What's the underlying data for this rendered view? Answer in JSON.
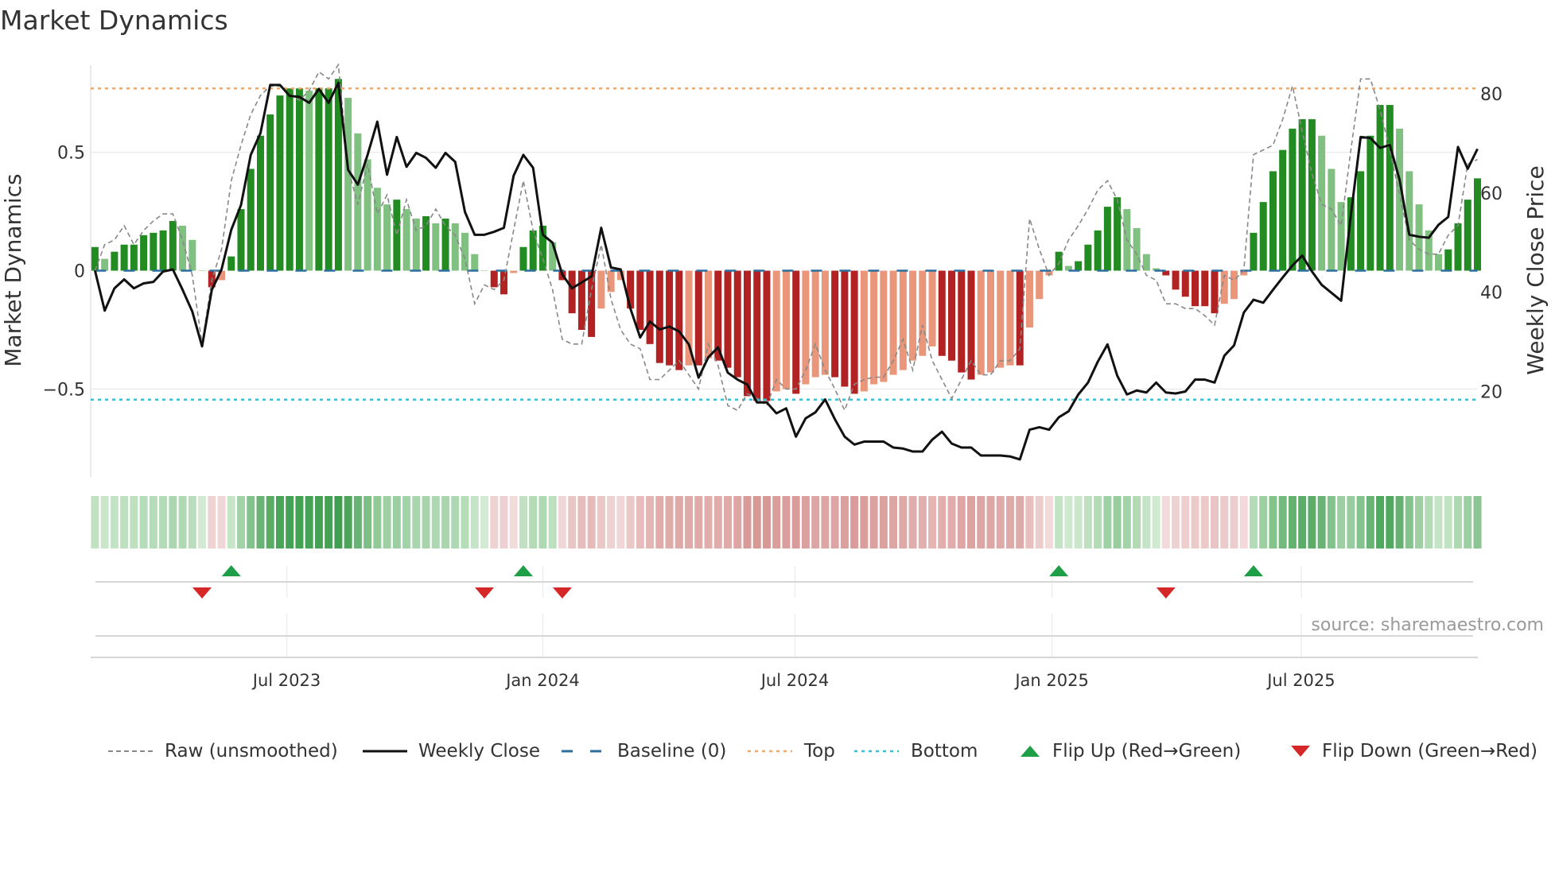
{
  "title": "Market Dynamics",
  "source": "source: sharemaestro.com",
  "legend": [
    {
      "label": "Raw (unsmoothed)",
      "icon": "dashed-gray-line"
    },
    {
      "label": "Weekly Close",
      "icon": "solid-black-line"
    },
    {
      "label": "Baseline (0)",
      "icon": "dashed-blue-line"
    },
    {
      "label": "Top",
      "icon": "dotted-orange-line"
    },
    {
      "label": "Bottom",
      "icon": "dotted-cyan-line"
    },
    {
      "label": "Flip Up (Red→Green)",
      "icon": "triangle-up"
    },
    {
      "label": "Flip Down (Green→Red)",
      "icon": "triangle-down"
    }
  ],
  "colors": {
    "pos_strong": "#228b22",
    "pos_weak": "#80c080",
    "neg_strong": "#b22222",
    "neg_weak": "#e9967a",
    "raw": "#888888",
    "close": "#111111",
    "baseline": "#2b6f9f",
    "top": "#f0a868",
    "bottom": "#2ec4d6",
    "flip_up": "#1f9e48",
    "flip_down": "#d62728"
  },
  "chart_data": {
    "type": "bar+line",
    "title": "Market Dynamics",
    "ylabel": "Market Dynamics",
    "y2label": "Weekly Close Price",
    "ylim": [
      -0.7,
      0.87
    ],
    "yticks": [
      {
        "v": 0.5,
        "label": "0.5"
      },
      {
        "v": 0,
        "label": "0"
      },
      {
        "v": -0.5,
        "label": "−0.5"
      }
    ],
    "y2ticks": [
      {
        "v": 80,
        "label": "80"
      },
      {
        "v": 60,
        "label": "60"
      },
      {
        "v": 40,
        "label": "40"
      },
      {
        "v": 20,
        "label": "20"
      }
    ],
    "x_start": "2023-02-13",
    "x_interval": "weekly",
    "xticks": [
      {
        "week": 19.7,
        "label": "Jul 2023"
      },
      {
        "week": 46,
        "label": "Jan 2024"
      },
      {
        "week": 71.9,
        "label": "Jul 2024"
      },
      {
        "week": 98.3,
        "label": "Jan 2025"
      },
      {
        "week": 123.9,
        "label": "Jul 2025"
      }
    ],
    "top_level": 0.77,
    "bottom_level": -0.545,
    "baseline": 0,
    "smoothed": [
      0.1,
      0.05,
      0.08,
      0.11,
      0.11,
      0.15,
      0.16,
      0.17,
      0.21,
      0.19,
      0.13,
      0.0,
      -0.07,
      -0.04,
      0.06,
      0.26,
      0.43,
      0.57,
      0.66,
      0.74,
      0.77,
      0.77,
      0.76,
      0.77,
      0.77,
      0.81,
      0.73,
      0.58,
      0.47,
      0.35,
      0.28,
      0.3,
      0.26,
      0.22,
      0.23,
      0.2,
      0.22,
      0.2,
      0.16,
      0.07,
      0.0,
      -0.07,
      -0.1,
      -0.01,
      0.1,
      0.17,
      0.19,
      0.12,
      -0.04,
      -0.18,
      -0.25,
      -0.28,
      -0.16,
      -0.09,
      -0.04,
      -0.16,
      -0.25,
      -0.31,
      -0.39,
      -0.4,
      -0.42,
      -0.4,
      -0.4,
      -0.37,
      -0.38,
      -0.41,
      -0.45,
      -0.53,
      -0.55,
      -0.55,
      -0.51,
      -0.5,
      -0.52,
      -0.48,
      -0.45,
      -0.44,
      -0.45,
      -0.49,
      -0.52,
      -0.51,
      -0.48,
      -0.47,
      -0.44,
      -0.42,
      -0.38,
      -0.36,
      -0.32,
      -0.36,
      -0.38,
      -0.43,
      -0.46,
      -0.44,
      -0.43,
      -0.41,
      -0.4,
      -0.4,
      -0.24,
      -0.12,
      -0.02,
      0.08,
      0.02,
      0.04,
      0.11,
      0.17,
      0.27,
      0.31,
      0.26,
      0.18,
      0.07,
      0.01,
      -0.02,
      -0.08,
      -0.11,
      -0.15,
      -0.15,
      -0.18,
      -0.14,
      -0.12,
      -0.02,
      0.16,
      0.29,
      0.42,
      0.51,
      0.6,
      0.64,
      0.64,
      0.57,
      0.43,
      0.29,
      0.31,
      0.42,
      0.57,
      0.7,
      0.7,
      0.6,
      0.42,
      0.28,
      0.17,
      0.07,
      0.09,
      0.2,
      0.3,
      0.39
    ],
    "raw": [
      0.0,
      0.11,
      0.13,
      0.19,
      0.11,
      0.17,
      0.21,
      0.24,
      0.24,
      0.13,
      -0.02,
      -0.31,
      -0.04,
      0.09,
      0.38,
      0.53,
      0.66,
      0.74,
      0.78,
      0.78,
      0.74,
      0.72,
      0.76,
      0.84,
      0.81,
      0.87,
      0.43,
      0.28,
      0.45,
      0.24,
      0.32,
      0.15,
      0.3,
      0.17,
      0.19,
      0.26,
      0.19,
      0.15,
      0.05,
      -0.14,
      -0.06,
      -0.08,
      -0.04,
      0.17,
      0.38,
      0.17,
      0.05,
      -0.08,
      -0.29,
      -0.31,
      -0.31,
      -0.08,
      0.11,
      -0.12,
      -0.25,
      -0.31,
      -0.33,
      -0.46,
      -0.46,
      -0.42,
      -0.38,
      -0.44,
      -0.5,
      -0.31,
      -0.4,
      -0.57,
      -0.59,
      -0.52,
      -0.54,
      -0.57,
      -0.46,
      -0.5,
      -0.5,
      -0.42,
      -0.31,
      -0.42,
      -0.5,
      -0.59,
      -0.48,
      -0.46,
      -0.45,
      -0.45,
      -0.38,
      -0.29,
      -0.42,
      -0.23,
      -0.38,
      -0.46,
      -0.54,
      -0.46,
      -0.38,
      -0.44,
      -0.44,
      -0.38,
      -0.38,
      -0.33,
      0.22,
      0.09,
      -0.02,
      0.03,
      0.13,
      0.19,
      0.26,
      0.34,
      0.38,
      0.3,
      0.13,
      0.07,
      -0.02,
      -0.04,
      -0.14,
      -0.14,
      -0.16,
      -0.16,
      -0.19,
      -0.23,
      -0.02,
      -0.04,
      0.0,
      0.49,
      0.51,
      0.53,
      0.64,
      0.78,
      0.59,
      0.41,
      0.28,
      0.26,
      0.19,
      0.51,
      0.81,
      0.81,
      0.68,
      0.51,
      0.32,
      0.13,
      0.09,
      0.07,
      0.07,
      0.15,
      0.19,
      0.45,
      0.47
    ],
    "weekly_close": [
      44.4,
      36.3,
      40.8,
      42.6,
      40.8,
      41.8,
      42.1,
      44.2,
      44.6,
      40.5,
      36.1,
      29.1,
      40.5,
      44.6,
      52.6,
      57.6,
      67.7,
      72.1,
      81.8,
      81.8,
      79.6,
      79.4,
      78.2,
      81.0,
      78.2,
      82.2,
      64.7,
      61.7,
      67.7,
      74.4,
      63.7,
      71.3,
      65.3,
      68.1,
      67.1,
      65.1,
      68.1,
      66.3,
      56.2,
      51.6,
      51.6,
      52.2,
      53.0,
      63.5,
      67.7,
      65.1,
      51.6,
      50.0,
      43.6,
      40.8,
      42.0,
      43.2,
      53.0,
      45.0,
      44.6,
      36.7,
      30.9,
      34.1,
      32.5,
      33.1,
      32.1,
      29.5,
      22.8,
      26.9,
      28.9,
      23.8,
      22.4,
      21.4,
      17.8,
      17.8,
      15.6,
      16.6,
      10.9,
      14.6,
      15.8,
      18.4,
      14.4,
      10.9,
      9.3,
      9.9,
      9.9,
      9.9,
      8.7,
      8.5,
      7.9,
      7.9,
      10.3,
      11.9,
      9.5,
      8.7,
      8.7,
      7.1,
      7.1,
      7.1,
      6.9,
      6.3,
      12.3,
      12.8,
      12.3,
      14.8,
      16.0,
      19.4,
      21.8,
      26.0,
      29.5,
      23.2,
      19.4,
      20.2,
      19.8,
      21.8,
      19.8,
      19.6,
      20.0,
      22.4,
      22.4,
      21.8,
      27.2,
      29.3,
      35.9,
      38.5,
      37.9,
      40.5,
      43.0,
      45.4,
      47.4,
      44.2,
      41.5,
      39.9,
      38.3,
      55.6,
      71.3,
      71.1,
      69.1,
      69.7,
      62.7,
      51.6,
      51.2,
      51.0,
      53.6,
      55.2,
      69.3,
      64.9,
      68.9
    ],
    "flip_up_weeks": [
      14,
      44,
      99,
      119
    ],
    "flip_down_weeks": [
      11,
      40,
      48,
      110
    ],
    "grid": true,
    "legend_position": "bottom"
  }
}
